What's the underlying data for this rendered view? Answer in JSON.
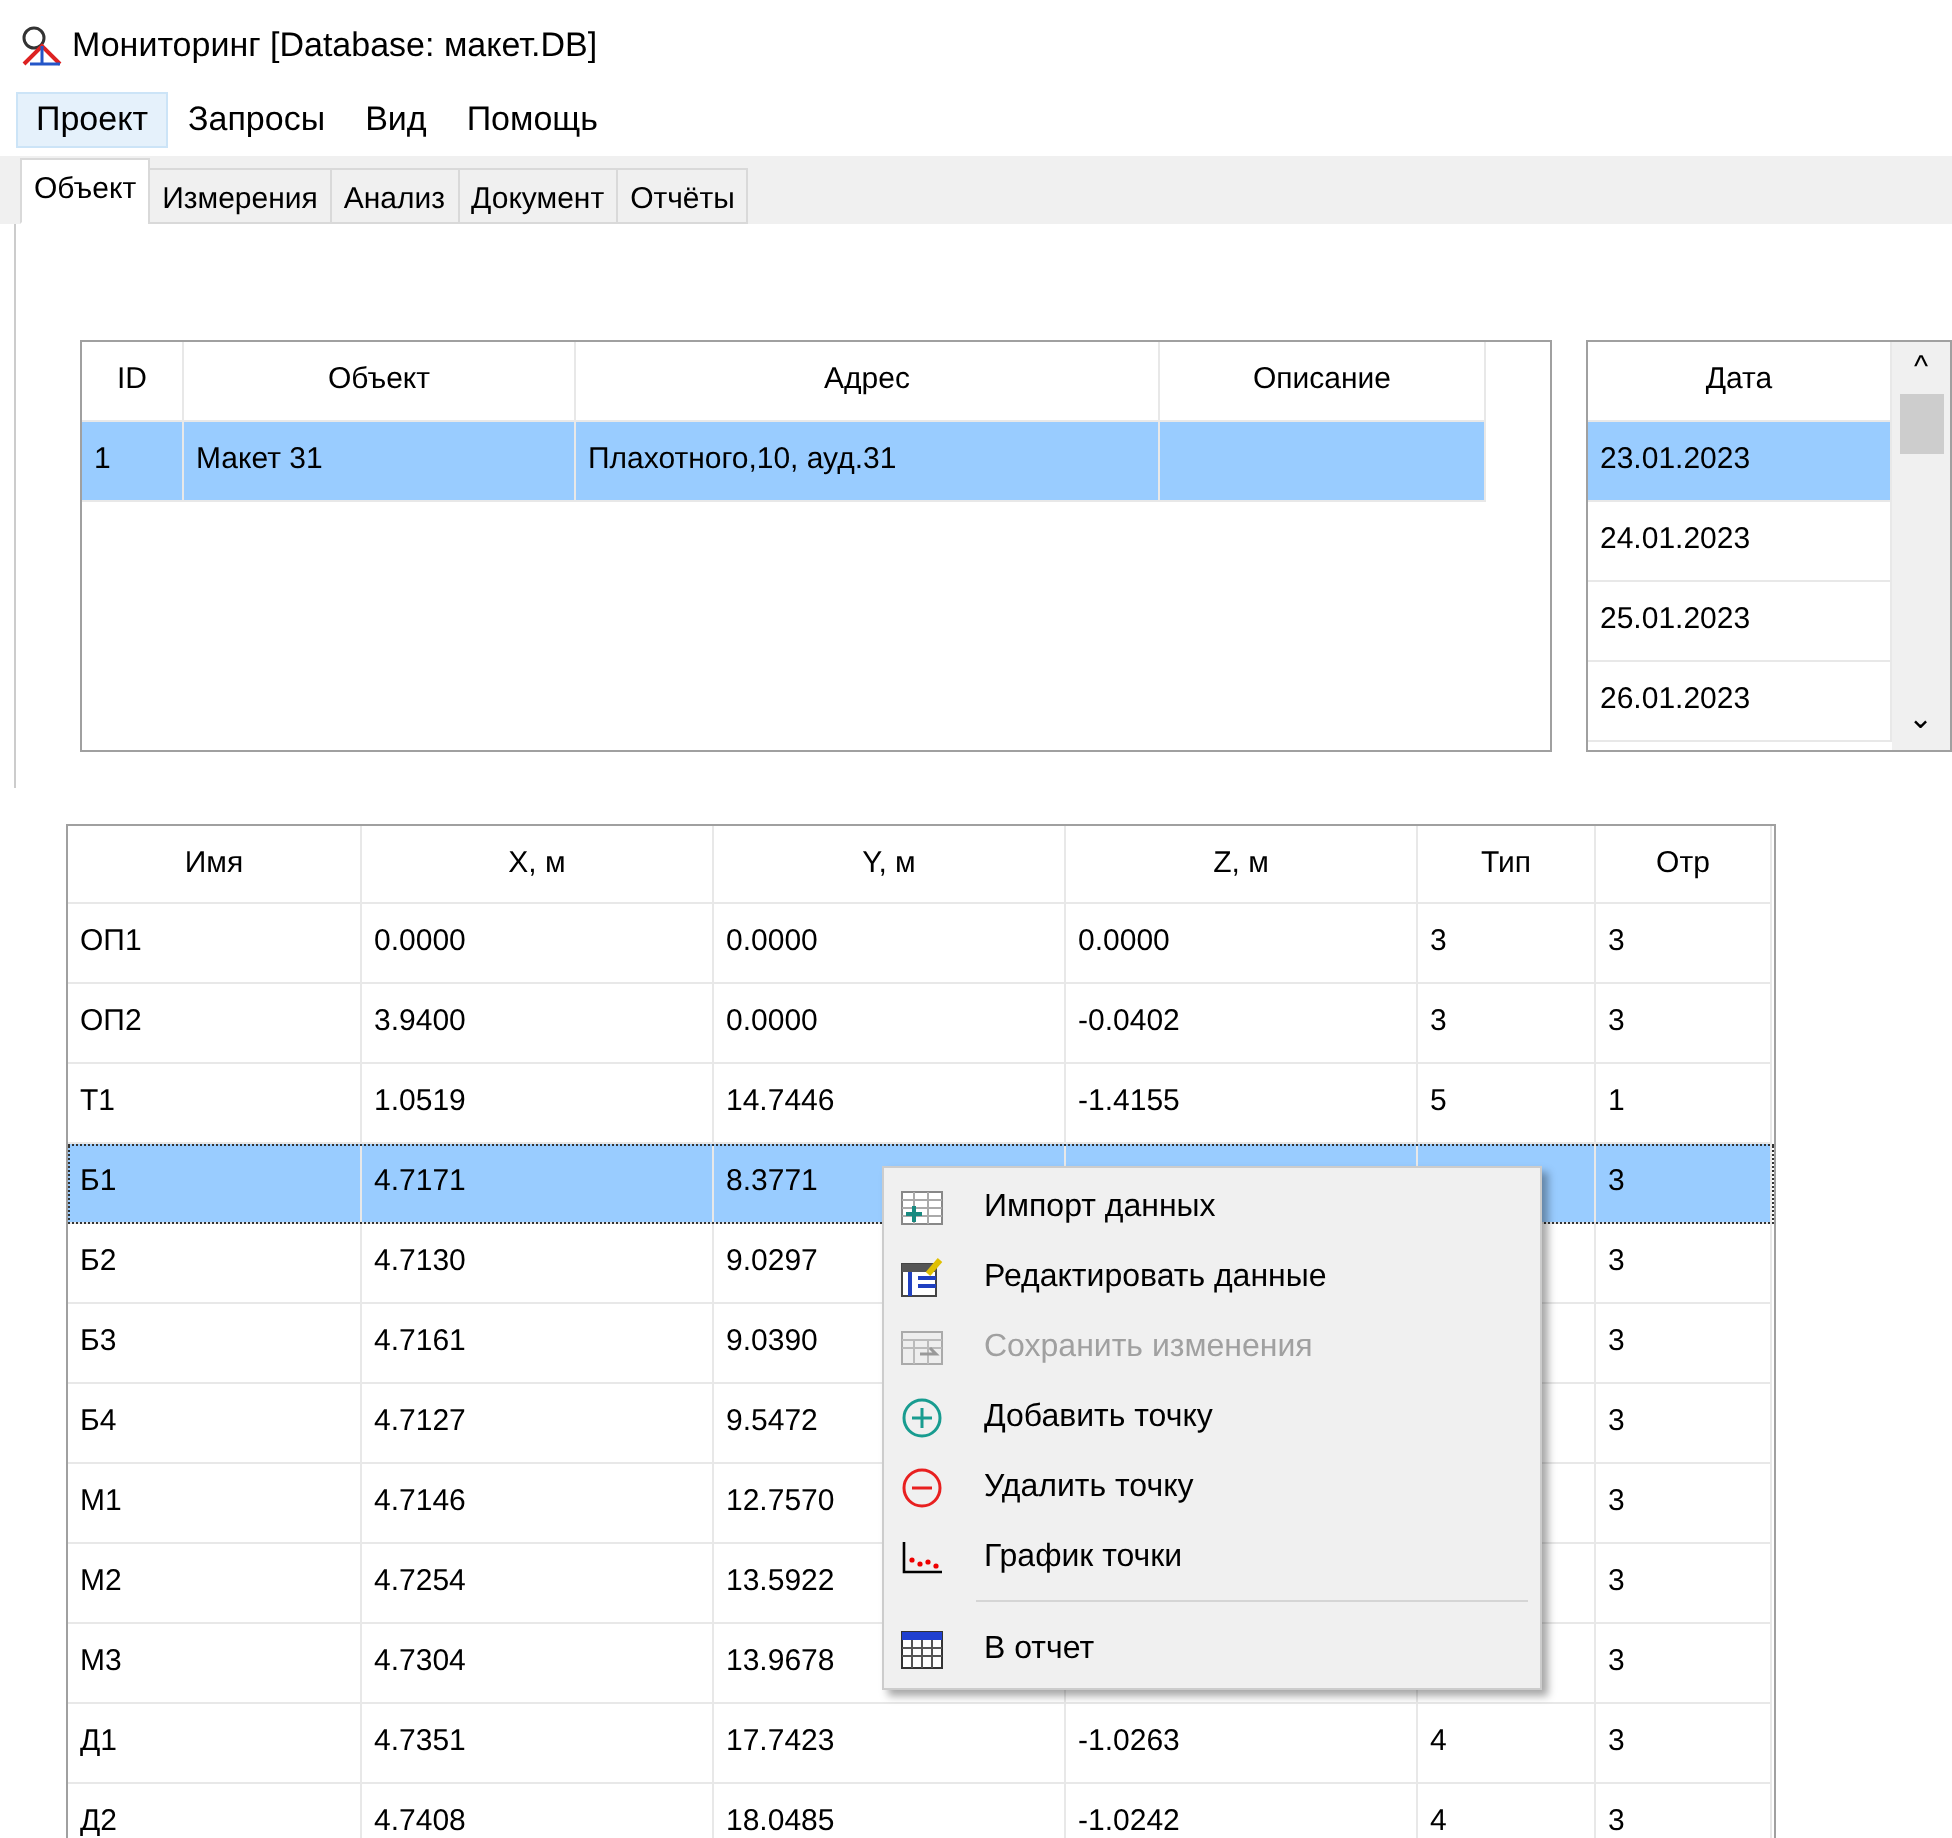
{
  "window": {
    "title": "Мониторинг  [Database: макет.DB]"
  },
  "menu_bar": [
    {
      "label": "Проект",
      "selected": true
    },
    {
      "label": "Запросы",
      "selected": false
    },
    {
      "label": "Вид",
      "selected": false
    },
    {
      "label": "Помощь",
      "selected": false
    }
  ],
  "tabs": [
    {
      "label": "Объект",
      "selected": true
    },
    {
      "label": "Измерения",
      "selected": false
    },
    {
      "label": "Анализ",
      "selected": false
    },
    {
      "label": "Документ",
      "selected": false
    },
    {
      "label": "Отчёты",
      "selected": false
    }
  ],
  "objects_table": {
    "columns": [
      "ID",
      "Объект",
      "Адрес",
      "Описание"
    ],
    "rows": [
      {
        "cells": [
          "1",
          "Макет 31",
          "Плахотного,10, ауд.31",
          null
        ],
        "selected": true
      }
    ]
  },
  "dates_list": {
    "column": "Дата",
    "rows": [
      {
        "label": "23.01.2023",
        "selected": true
      },
      {
        "label": "24.01.2023",
        "selected": false
      },
      {
        "label": "25.01.2023",
        "selected": false
      },
      {
        "label": "26.01.2023",
        "selected": false
      }
    ],
    "scroll_up": "^",
    "scroll_down": "⌄"
  },
  "points_table": {
    "columns": [
      "Имя",
      "X, м",
      "Y, м",
      "Z, м",
      "Тип",
      "Отр"
    ],
    "rows": [
      {
        "cells": [
          "ОП1",
          "0.0000",
          "0.0000",
          "0.0000",
          "3",
          "3"
        ],
        "selected": false
      },
      {
        "cells": [
          "ОП2",
          "3.9400",
          "0.0000",
          "-0.0402",
          "3",
          "3"
        ],
        "selected": false
      },
      {
        "cells": [
          "Т1",
          "1.0519",
          "14.7446",
          "-1.4155",
          "5",
          "1"
        ],
        "selected": false
      },
      {
        "cells": [
          "Б1",
          "4.7171",
          "8.3771",
          null,
          null,
          "3"
        ],
        "selected": true
      },
      {
        "cells": [
          "Б2",
          "4.7130",
          "9.0297",
          null,
          null,
          "3"
        ],
        "selected": false
      },
      {
        "cells": [
          "Б3",
          "4.7161",
          "9.0390",
          null,
          null,
          "3"
        ],
        "selected": false
      },
      {
        "cells": [
          "Б4",
          "4.7127",
          "9.5472",
          null,
          null,
          "3"
        ],
        "selected": false
      },
      {
        "cells": [
          "М1",
          "4.7146",
          "12.7570",
          null,
          null,
          "3"
        ],
        "selected": false
      },
      {
        "cells": [
          "М2",
          "4.7254",
          "13.5922",
          null,
          null,
          "3"
        ],
        "selected": false
      },
      {
        "cells": [
          "М3",
          "4.7304",
          "13.9678",
          null,
          null,
          "3"
        ],
        "selected": false
      },
      {
        "cells": [
          "Д1",
          "4.7351",
          "17.7423",
          "-1.0263",
          "4",
          "3"
        ],
        "selected": false
      },
      {
        "cells": [
          "Д2",
          "4.7408",
          "18.0485",
          "-1.0242",
          "4",
          "3"
        ],
        "selected": false
      }
    ]
  },
  "context_menu": [
    {
      "kind": "import",
      "label": "Импорт данных",
      "disabled": false
    },
    {
      "kind": "edit",
      "label": "Редактировать данные",
      "disabled": false
    },
    {
      "kind": "save",
      "label": "Сохранить изменения",
      "disabled": true
    },
    {
      "kind": "add",
      "label": "Добавить точку",
      "disabled": false
    },
    {
      "kind": "remove",
      "label": "Удалить точку",
      "disabled": false
    },
    {
      "kind": "chart",
      "label": "График точки",
      "disabled": false
    },
    {
      "kind": "separator"
    },
    {
      "kind": "report",
      "label": "В отчет",
      "disabled": false
    }
  ]
}
